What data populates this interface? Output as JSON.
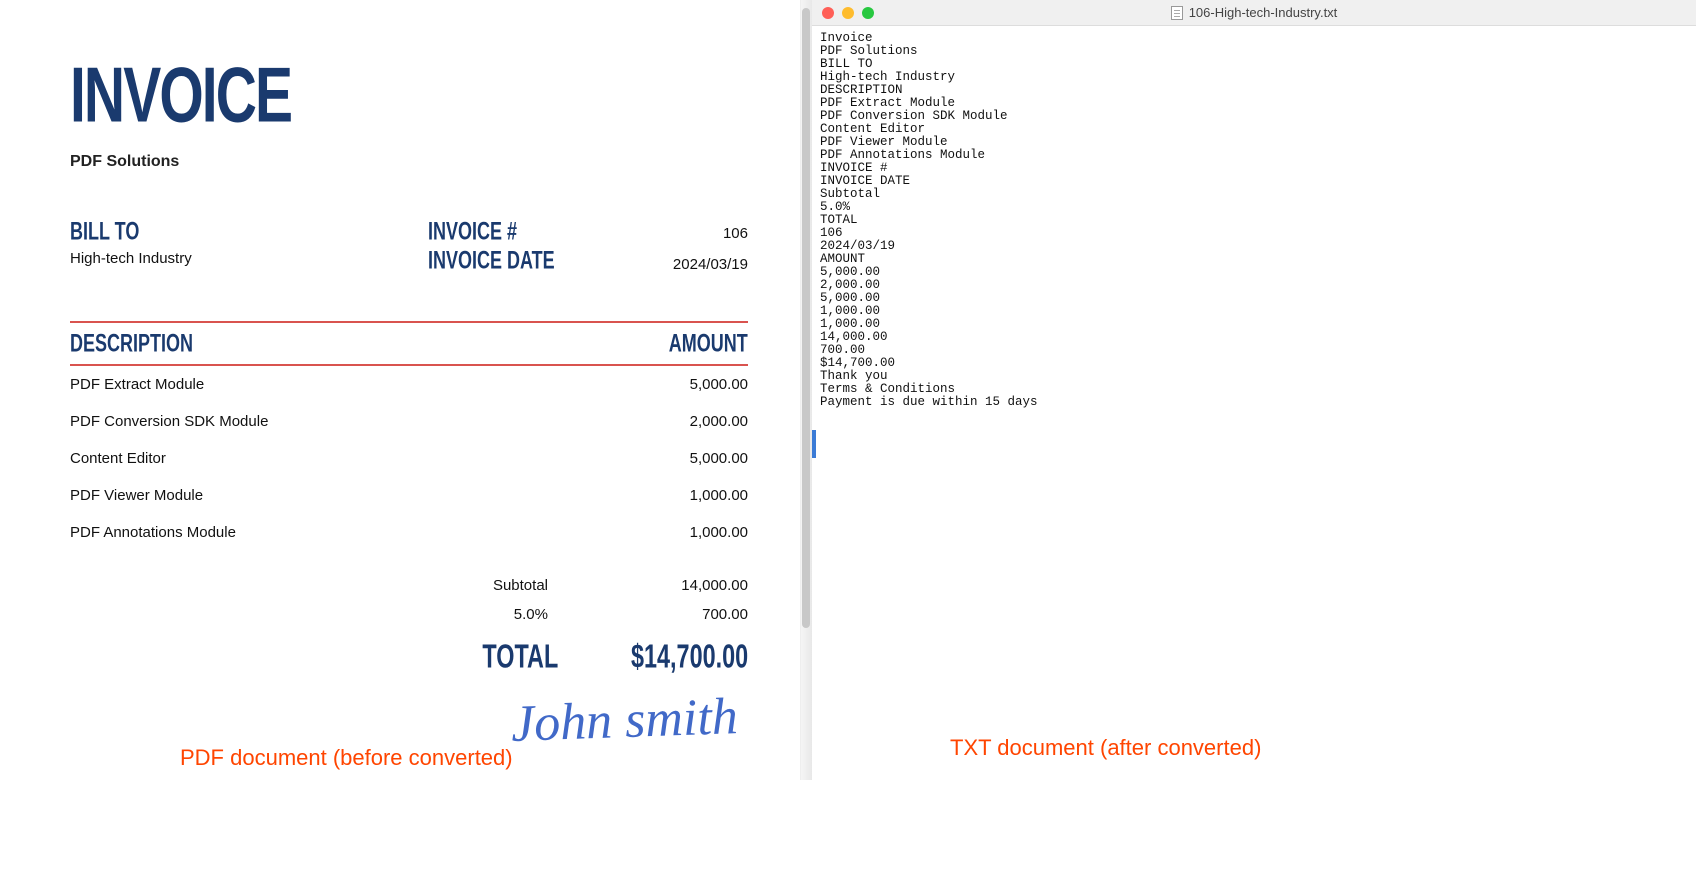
{
  "invoice": {
    "title": "INVOICE",
    "company": "PDF Solutions",
    "bill_to_label": "BILL TO",
    "bill_to_value": "High-tech Industry",
    "invoice_no_label": "INVOICE #",
    "invoice_no_value": "106",
    "invoice_date_label": "INVOICE DATE",
    "invoice_date_value": "2024/03/19",
    "desc_header": "DESCRIPTION",
    "amount_header": "AMOUNT",
    "lines": [
      {
        "desc": "PDF Extract Module",
        "amount": "5,000.00"
      },
      {
        "desc": "PDF Conversion SDK Module",
        "amount": "2,000.00"
      },
      {
        "desc": "Content Editor",
        "amount": "5,000.00"
      },
      {
        "desc": "PDF Viewer Module",
        "amount": "1,000.00"
      },
      {
        "desc": "PDF Annotations Module",
        "amount": "1,000.00"
      }
    ],
    "subtotal_label": "Subtotal",
    "subtotal_value": "14,000.00",
    "tax_label": "5.0%",
    "tax_value": "700.00",
    "total_label": "TOTAL",
    "total_value": "$14,700.00",
    "signature": "John smith"
  },
  "txt": {
    "window_title": "106-High-tech-Industry.txt",
    "lines": [
      "Invoice",
      "PDF Solutions",
      "BILL TO",
      "High-tech Industry",
      "DESCRIPTION",
      "PDF Extract Module",
      "PDF Conversion SDK Module",
      "Content Editor",
      "PDF Viewer Module",
      "PDF Annotations Module",
      "INVOICE #",
      "INVOICE DATE",
      "Subtotal",
      "5.0%",
      "TOTAL",
      "106",
      "2024/03/19",
      "AMOUNT",
      "5,000.00",
      "2,000.00",
      "5,000.00",
      "1,000.00",
      "1,000.00",
      "14,000.00",
      "700.00",
      "$14,700.00",
      "Thank you",
      "Terms & Conditions",
      "Payment is due within 15 days"
    ]
  },
  "captions": {
    "left": "PDF document (before converted)",
    "right": "TXT document (after converted)"
  }
}
